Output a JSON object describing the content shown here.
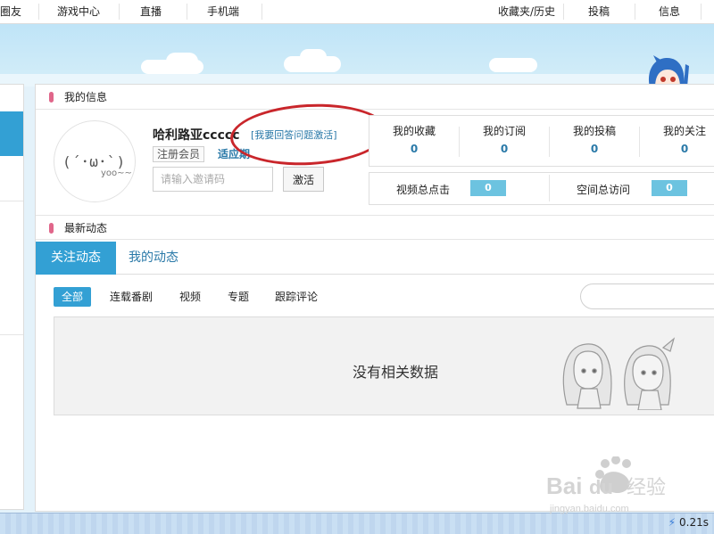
{
  "nav": {
    "items": [
      "圈友",
      "游戏中心",
      "直播",
      "手机端",
      "收藏夹/历史",
      "投稿",
      "信息"
    ]
  },
  "profile": {
    "section_title": "我的信息",
    "avatar_face": "(´･ω･`)",
    "avatar_caption": "yoo~~",
    "username": "哈利路亚ccccc",
    "question_link": "[我要回答问题激活]",
    "member_badge": "注册会员",
    "trial_label": "适应期",
    "invite_placeholder": "请输入邀请码",
    "activate_label": "激活"
  },
  "stats": [
    {
      "label": "我的收藏",
      "value": "0"
    },
    {
      "label": "我的订阅",
      "value": "0"
    },
    {
      "label": "我的投稿",
      "value": "0"
    },
    {
      "label": "我的关注",
      "value": "0"
    }
  ],
  "totals": {
    "video_clicks_label": "视频总点击",
    "video_clicks_value": "0",
    "space_visits_label": "空间总访问",
    "space_visits_value": "0"
  },
  "feed": {
    "section_title": "最新动态",
    "tabs": [
      "关注动态",
      "我的动态"
    ],
    "filters": [
      "全部",
      "连载番剧",
      "视频",
      "专题",
      "跟踪评论"
    ],
    "empty_message": "没有相关数据"
  },
  "status": {
    "load_time": "0.21s"
  },
  "watermark": {
    "brand": "Baidu经验",
    "url": "jingyan.baidu.com"
  },
  "colors": {
    "accent": "#33a0d4",
    "link": "#2a79a8",
    "annotation": "#c9262b",
    "pin": "#e0668a"
  }
}
